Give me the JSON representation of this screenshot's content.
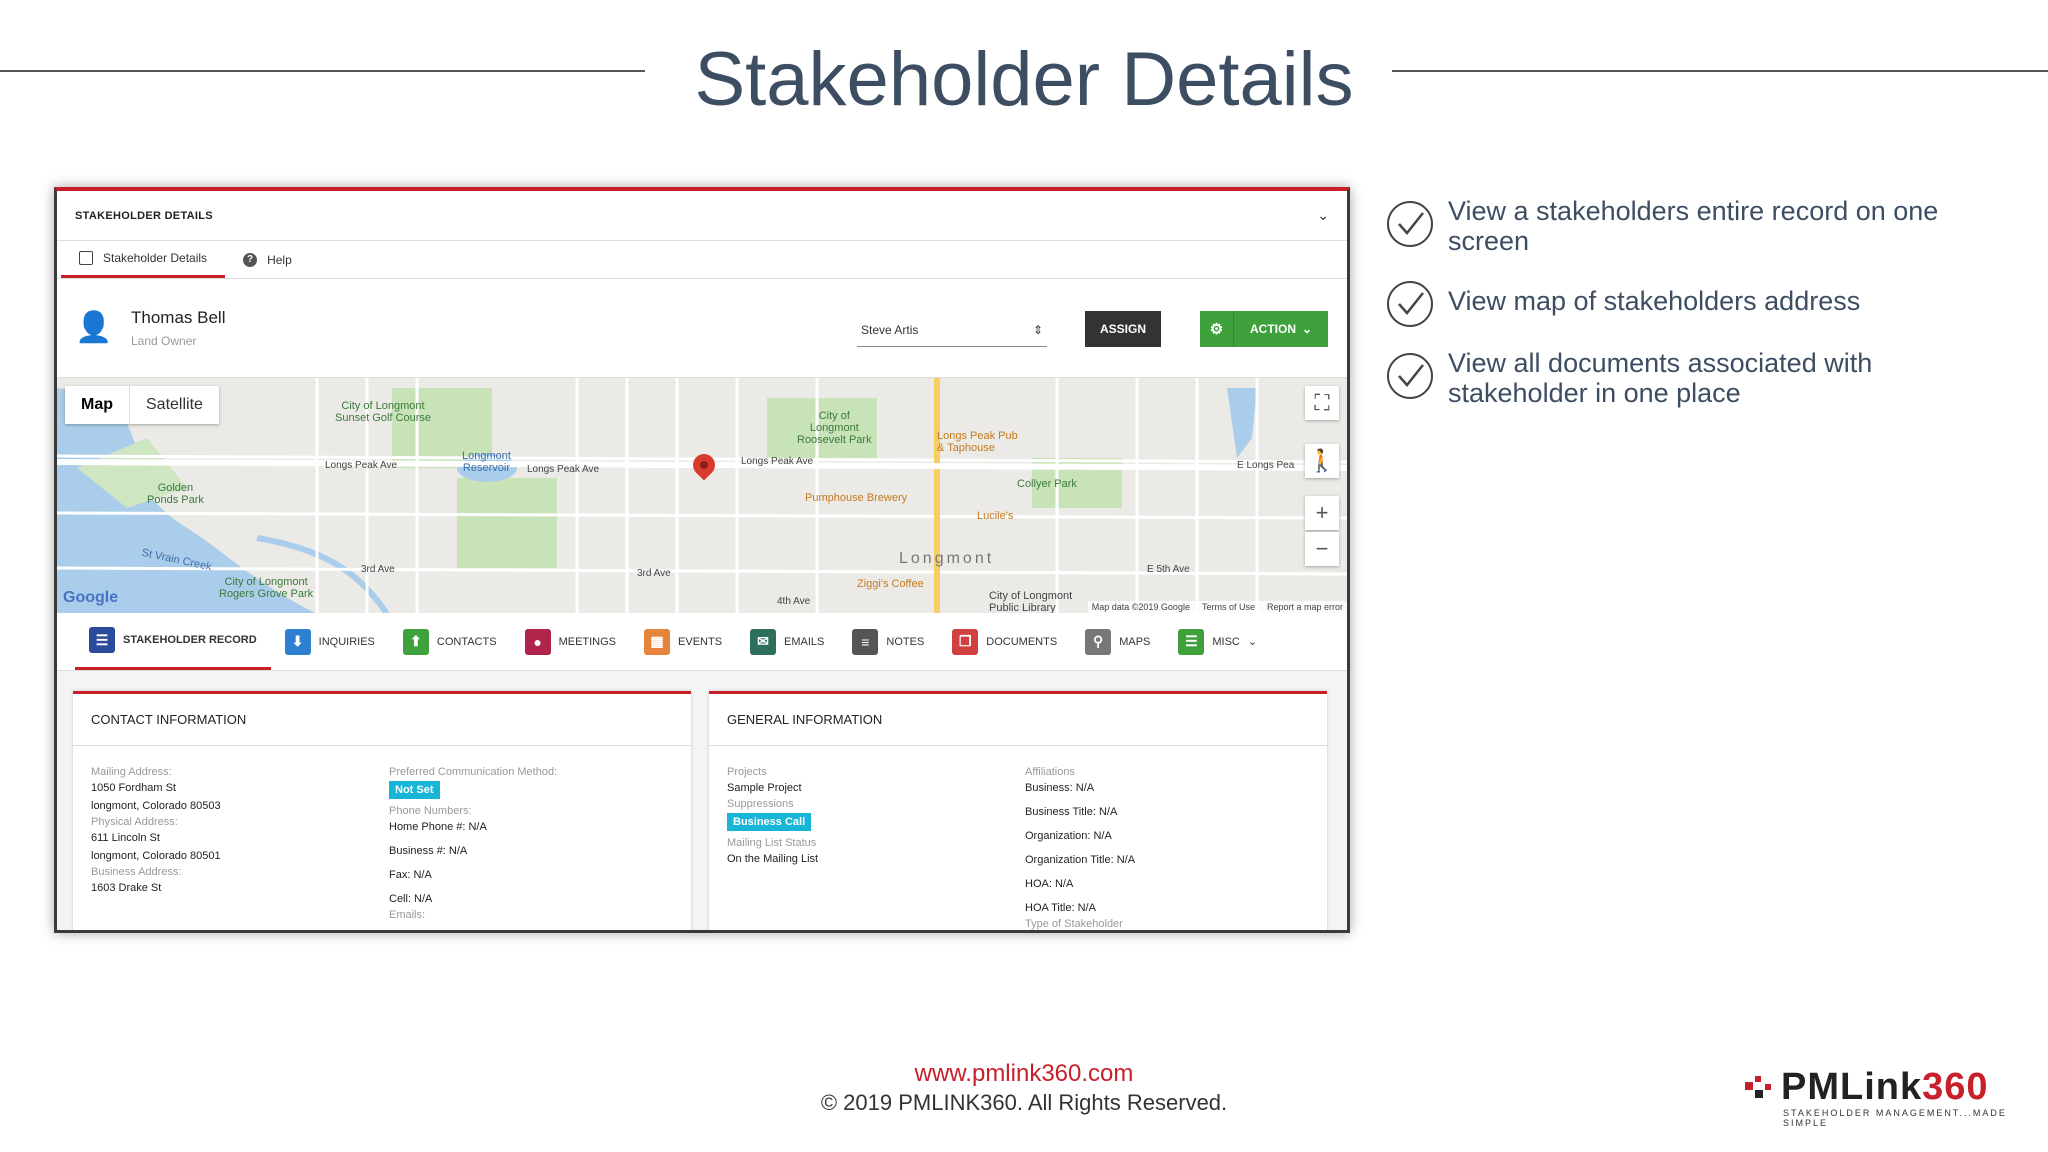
{
  "slide": {
    "title": "Stakeholder Details",
    "website": "www.pmlink360.com",
    "copyright": "© 2019 PMLINK360. All Rights Reserved.",
    "logo_text_a": "PMLink",
    "logo_text_b": "360",
    "logo_tagline": "STAKEHOLDER MANAGEMENT...MADE SIMPLE"
  },
  "bullets": [
    {
      "text": "View a stakeholders entire record on one screen"
    },
    {
      "text": "View map of  stakeholders address"
    },
    {
      "text": "View all documents associated with stakeholder in one place"
    }
  ],
  "app": {
    "panel_title": "STAKEHOLDER DETAILS",
    "tabs": [
      {
        "label": "Stakeholder Details"
      },
      {
        "label": "Help"
      }
    ],
    "person": {
      "name": "Thomas Bell",
      "role": "Land Owner"
    },
    "assignee": "Steve Artis",
    "assign_label": "ASSIGN",
    "action_label": "ACTION",
    "map": {
      "toggle_map": "Map",
      "toggle_satellite": "Satellite",
      "google": "Google",
      "footer": [
        "Map data ©2019 Google",
        "Terms of Use",
        "Report a map error"
      ],
      "labels": {
        "golf": "City of Longmont\nSunset Golf Course",
        "reservoir": "Longmont\nReservoir",
        "golden": "Golden\nPonds Park",
        "roosevelt": "City of\nLongmont\nRoosevelt Park",
        "pub": "Longs Peak Pub\n& Taphouse",
        "collyer": "Collyer Park",
        "pumphouse": "Pumphouse Brewery",
        "lucile": "Lucile's",
        "longmont": "Longmont",
        "ziggi": "Ziggi's Coffee",
        "library": "City of Longmont\nPublic Library",
        "rogers": "City of Longmont\nRogers Grove Park",
        "stvrain": "St Vrain Creek",
        "longs1": "Longs Peak Ave",
        "longs2": "Longs Peak Ave",
        "longs3": "Longs Peak Ave",
        "elongs": "E Longs Pea",
        "third": "3rd Ave",
        "third2": "3rd Ave",
        "fourth": "4th Ave",
        "e5th": "E 5th Ave"
      }
    },
    "modules": [
      {
        "label": "STAKEHOLDER RECORD",
        "color": "#2b4c9a",
        "glyph": "☰"
      },
      {
        "label": "INQUIRIES",
        "color": "#2d7fd0",
        "glyph": "⬇"
      },
      {
        "label": "CONTACTS",
        "color": "#3ea13b",
        "glyph": "⬆"
      },
      {
        "label": "MEETINGS",
        "color": "#b0234a",
        "glyph": "●"
      },
      {
        "label": "EVENTS",
        "color": "#e6843a",
        "glyph": "▦"
      },
      {
        "label": "EMAILS",
        "color": "#2d6f5c",
        "glyph": "✉"
      },
      {
        "label": "NOTES",
        "color": "#555555",
        "glyph": "≡"
      },
      {
        "label": "DOCUMENTS",
        "color": "#d14040",
        "glyph": "❐"
      },
      {
        "label": "MAPS",
        "color": "#777777",
        "glyph": "⚲"
      },
      {
        "label": "MISC",
        "color": "#3ea13b",
        "glyph": "☰"
      }
    ],
    "contact": {
      "title": "CONTACT INFORMATION",
      "mailing_label": "Mailing Address:",
      "mailing_1": "1050 Fordham St",
      "mailing_2": "longmont, Colorado 80503",
      "physical_label": "Physical Address:",
      "physical_1": "611 Lincoln St",
      "physical_2": "longmont, Colorado 80501",
      "business_label": "Business Address:",
      "business_1": "1603 Drake St",
      "pref_label": "Preferred Communication Method:",
      "pref_value": "Not Set",
      "phone_label": "Phone Numbers:",
      "home_phone": "Home Phone #: N/A",
      "business_phone": "Business #: N/A",
      "fax": "Fax: N/A",
      "cell": "Cell: N/A",
      "emails_label": "Emails:"
    },
    "general": {
      "title": "GENERAL INFORMATION",
      "projects_label": "Projects",
      "projects_value": "Sample Project",
      "suppressions_label": "Suppressions",
      "suppressions_value": "Business Call",
      "mailing_status_label": "Mailing List Status",
      "mailing_status_value": "On the Mailing List",
      "affiliations_label": "Affiliations",
      "business": "Business: N/A",
      "business_title": "Business Title: N/A",
      "organization": "Organization: N/A",
      "organization_title": "Organization Title: N/A",
      "hoa": "HOA: N/A",
      "hoa_title": "HOA Title: N/A",
      "type_label": "Type of Stakeholder"
    }
  }
}
